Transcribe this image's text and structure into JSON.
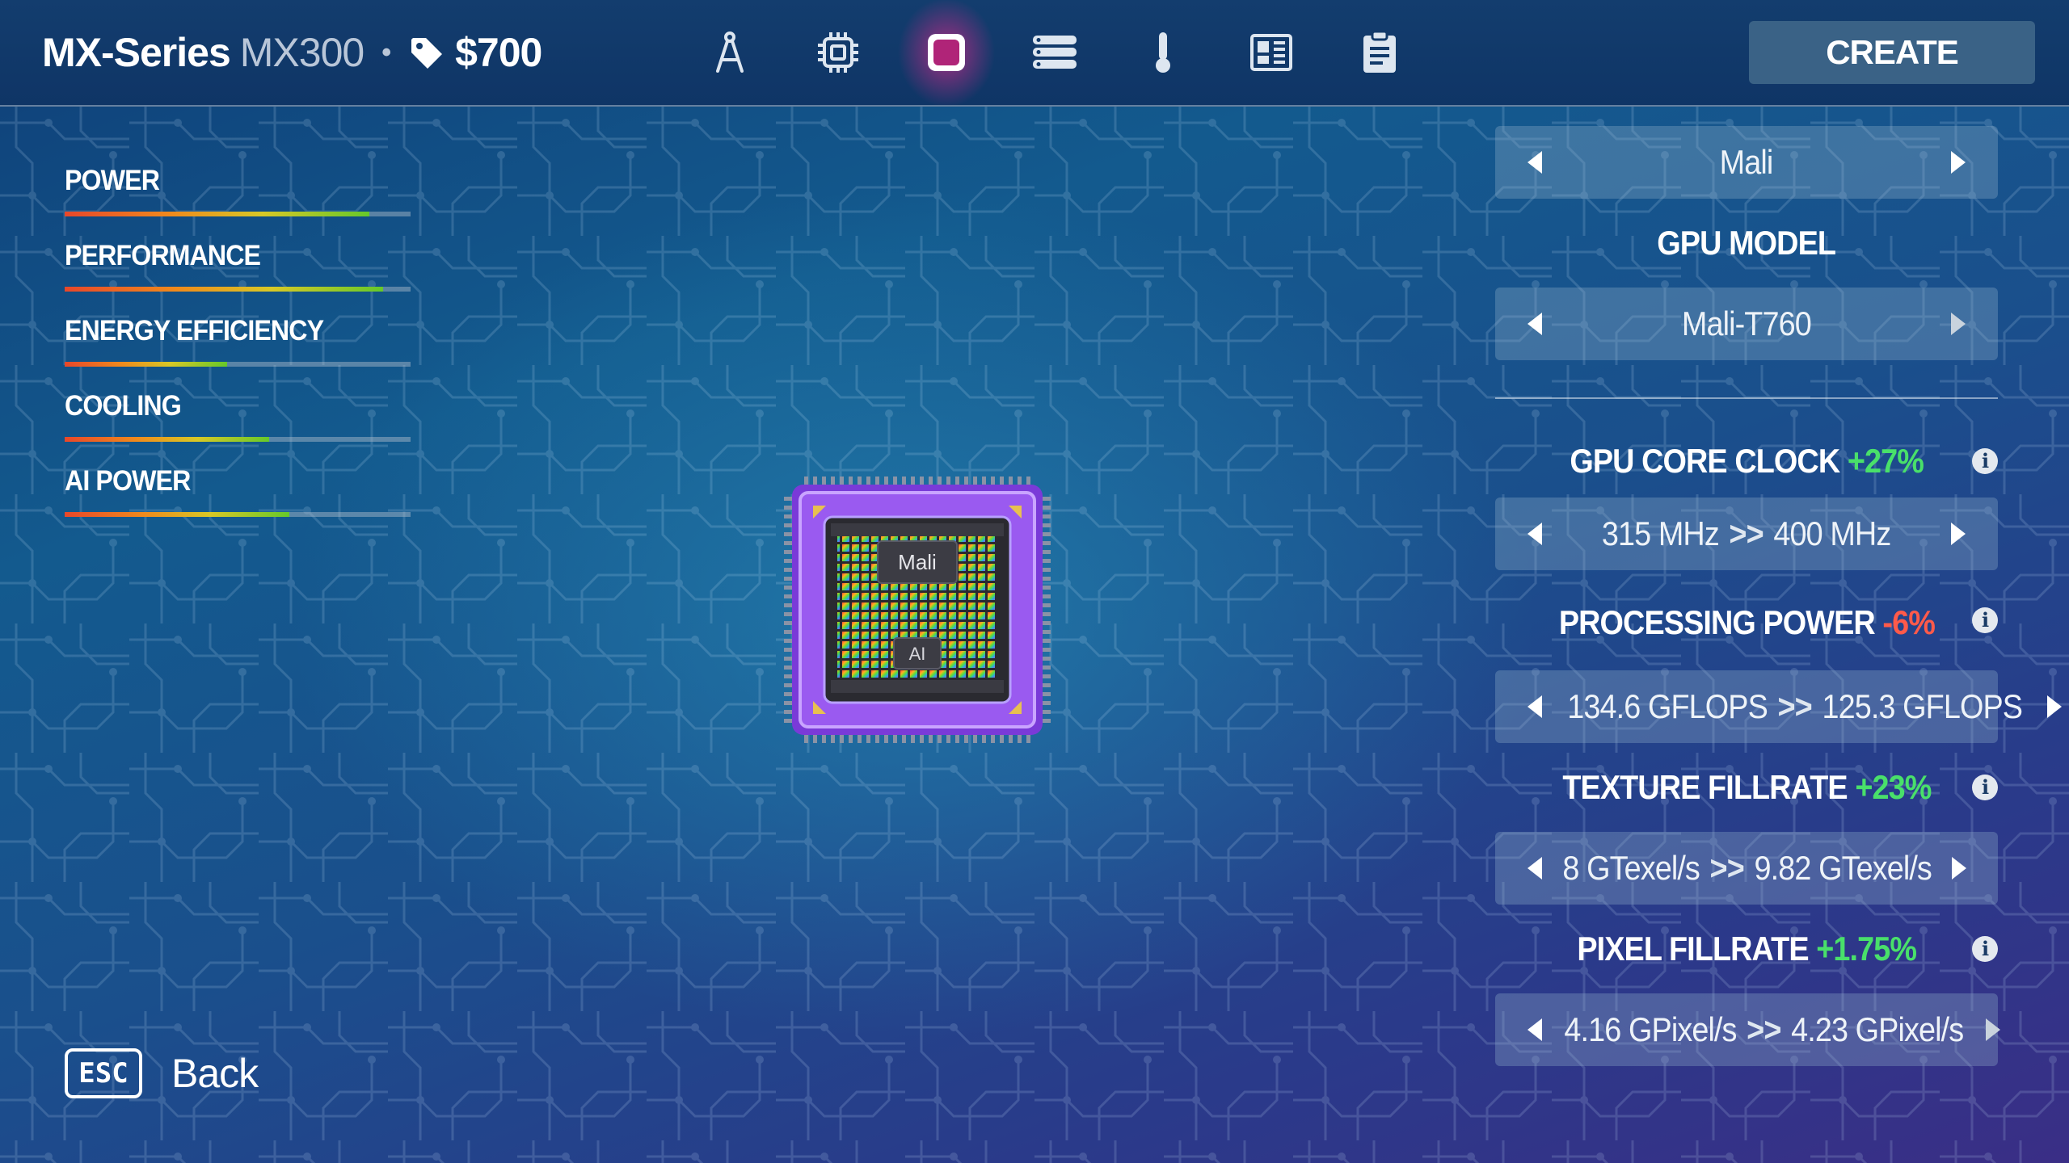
{
  "header": {
    "series": "MX-Series",
    "model": "MX300",
    "separator": "•",
    "price": "$700",
    "price_icon": "price-tag-icon",
    "create_label": "CREATE",
    "tabs": [
      {
        "icon": "compass-icon",
        "active": false
      },
      {
        "icon": "cpu-chip-icon",
        "active": false
      },
      {
        "icon": "gpu-square-icon",
        "active": true
      },
      {
        "icon": "memory-stack-icon",
        "active": false
      },
      {
        "icon": "thermometer-icon",
        "active": false
      },
      {
        "icon": "board-layout-icon",
        "active": false
      },
      {
        "icon": "clipboard-icon",
        "active": false
      }
    ]
  },
  "stats": [
    {
      "label": "POWER",
      "value": 0.88
    },
    {
      "label": "PERFORMANCE",
      "value": 0.92
    },
    {
      "label": "ENERGY EFFICIENCY",
      "value": 0.47
    },
    {
      "label": "COOLING",
      "value": 0.59
    },
    {
      "label": "AI POWER",
      "value": 0.65
    }
  ],
  "chip": {
    "name": "Mali",
    "sub": "AI"
  },
  "panel": {
    "vendor": "Mali",
    "gpu_model_heading": "GPU MODEL",
    "gpu_model": "Mali-T760",
    "specs": [
      {
        "label": "GPU CORE CLOCK",
        "delta": "+27%",
        "positive": true,
        "from": "315 MHz",
        "to": "400 MHz",
        "arrow": ">>",
        "right_dim": false
      },
      {
        "label": "PROCESSING POWER",
        "delta": "-6%",
        "positive": false,
        "from": "134.6 GFLOPS",
        "to": "125.3 GFLOPS",
        "arrow": ">>",
        "right_dim": false
      },
      {
        "label": "TEXTURE FILLRATE",
        "delta": "+23%",
        "positive": true,
        "from": "8 GTexel/s",
        "to": "9.82 GTexel/s",
        "arrow": ">>",
        "right_dim": false
      },
      {
        "label": "PIXEL FILLRATE",
        "delta": "+1.75%",
        "positive": true,
        "from": "4.16 GPixel/s",
        "to": "4.23 GPixel/s",
        "arrow": ">>",
        "right_dim": true
      }
    ],
    "info_glyph": "i"
  },
  "footer": {
    "key": "ESC",
    "back_label": "Back"
  }
}
